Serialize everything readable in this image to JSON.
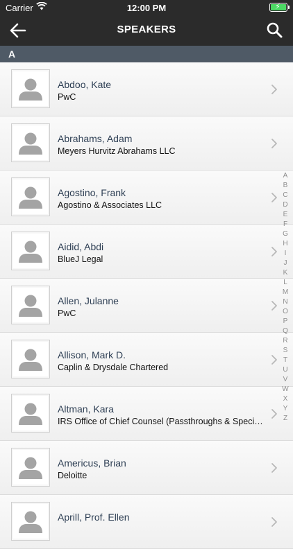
{
  "status": {
    "carrier": "Carrier",
    "time": "12:00 PM"
  },
  "navbar": {
    "title": "SPEAKERS"
  },
  "section": {
    "letter": "A"
  },
  "speakers": [
    {
      "name": "Abdoo, Kate",
      "org": "PwC"
    },
    {
      "name": "Abrahams, Adam",
      "org": "Meyers Hurvitz Abrahams LLC"
    },
    {
      "name": "Agostino, Frank",
      "org": "Agostino & Associates LLC"
    },
    {
      "name": "Aidid, Abdi",
      "org": "BlueJ Legal"
    },
    {
      "name": "Allen, Julanne",
      "org": "PwC"
    },
    {
      "name": "Allison, Mark D.",
      "org": "Caplin & Drysdale Chartered"
    },
    {
      "name": "Altman, Kara",
      "org": "IRS Office of Chief Counsel (Passthroughs & Special Industries)"
    },
    {
      "name": "Americus, Brian",
      "org": "Deloitte"
    },
    {
      "name": "Aprill, Prof. Ellen",
      "org": ""
    }
  ],
  "index": [
    "A",
    "B",
    "C",
    "D",
    "E",
    "F",
    "G",
    "H",
    "I",
    "J",
    "K",
    "L",
    "M",
    "N",
    "O",
    "P",
    "Q",
    "R",
    "S",
    "T",
    "U",
    "V",
    "W",
    "X",
    "Y",
    "Z"
  ],
  "icons": {
    "back": "arrow-left-icon",
    "search": "search-icon",
    "chevron": "chevron-right-icon",
    "avatar": "person-placeholder-icon"
  },
  "colors": {
    "nav_bg": "#2b2b2b",
    "section_bg": "#4f5a66",
    "name_text": "#2e3f54",
    "battery": "#4cd964"
  }
}
